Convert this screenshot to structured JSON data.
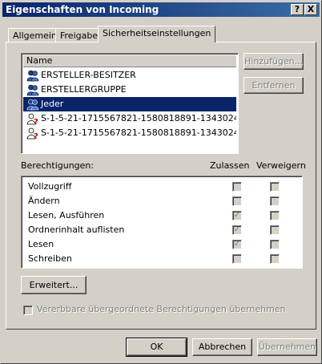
{
  "window": {
    "title": "Eigenschaften von Incoming",
    "help_glyph": "?",
    "close_glyph": "X"
  },
  "tabs": [
    {
      "label": "Allgemein",
      "active": false
    },
    {
      "label": "Freigabe",
      "active": false
    },
    {
      "label": "Sicherheitseinstellungen",
      "active": true
    }
  ],
  "users": {
    "column_header": "Name",
    "items": [
      {
        "name": "ERSTELLER-BESITZER",
        "icon": "group-icon",
        "selected": false
      },
      {
        "name": "ERSTELLERGRUPPE",
        "icon": "group-icon",
        "selected": false
      },
      {
        "name": "Jeder",
        "icon": "group-icon",
        "selected": true
      },
      {
        "name": "S-1-5-21-1715567821-1580818891-1343024091-...",
        "icon": "unknown-user-icon",
        "selected": false
      },
      {
        "name": "S-1-5-21-1715567821-1580818891-1343024091-...",
        "icon": "unknown-user-icon",
        "selected": false
      }
    ],
    "add_label": "Hinzufügen...",
    "remove_label": "Entfernen"
  },
  "permissions": {
    "label": "Berechtigungen:",
    "allow_header": "Zulassen",
    "deny_header": "Verweigern",
    "rows": [
      {
        "name": "Vollzugriff",
        "allow": false,
        "deny": false
      },
      {
        "name": "Ändern",
        "allow": false,
        "deny": false
      },
      {
        "name": "Lesen, Ausführen",
        "allow": true,
        "deny": false
      },
      {
        "name": "Ordnerinhalt auflisten",
        "allow": true,
        "deny": false
      },
      {
        "name": "Lesen",
        "allow": true,
        "deny": false
      },
      {
        "name": "Schreiben",
        "allow": false,
        "deny": false
      }
    ]
  },
  "advanced_label": "Erweitert...",
  "inherit_label": "Vererbbare übergeordnete Berechtigungen übernehmen",
  "footer": {
    "ok_label": "OK",
    "cancel_label": "Abbrechen",
    "apply_label": "Übernehmen"
  },
  "colors": {
    "titlebar_start": "#0a246a",
    "titlebar_end": "#3a6ea5",
    "face": "#d4d0c8",
    "selection": "#0a246a"
  }
}
